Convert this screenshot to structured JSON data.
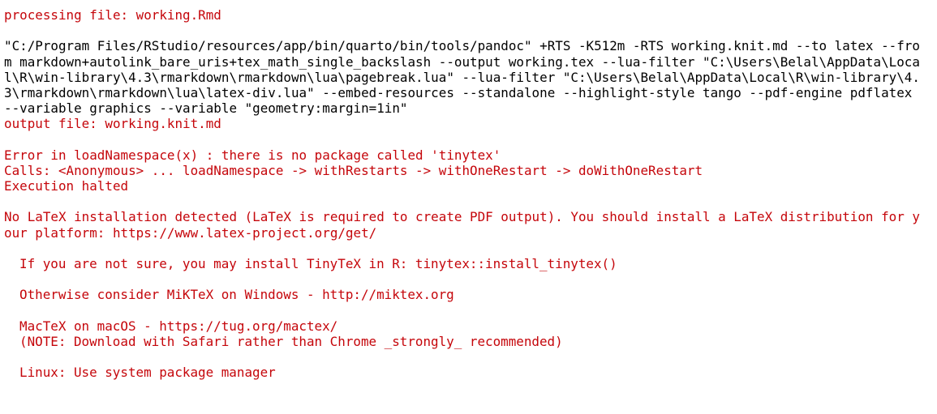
{
  "console": {
    "colors": {
      "message": "#c5060b",
      "command": "#000000",
      "background": "#ffffff"
    },
    "processing": "processing file: working.Rmd",
    "command_lines": [
      "\"C:/Program Files/RStudio/resources/app/bin/quarto/bin/tools/pandoc\" +RTS -K512m -RTS working.knit.md --to latex --fro",
      "m markdown+autolink_bare_uris+tex_math_single_backslash --output working.tex --lua-filter \"C:\\Users\\Belal\\AppData\\Loca",
      "l\\R\\win-library\\4.3\\rmarkdown\\rmarkdown\\lua\\pagebreak.lua\" --lua-filter \"C:\\Users\\Belal\\AppData\\Local\\R\\win-library\\4.",
      "3\\rmarkdown\\rmarkdown\\lua\\latex-div.lua\" --embed-resources --standalone --highlight-style tango --pdf-engine pdflatex",
      "--variable graphics --variable \"geometry:margin=1in\""
    ],
    "output_file": "output file: working.knit.md",
    "error": "Error in loadNamespace(x) : there is no package called 'tinytex'",
    "calls": "Calls: <Anonymous> ... loadNamespace -> withRestarts -> withOneRestart -> doWithOneRestart",
    "halted": "Execution halted",
    "latex_missing_1": "No LaTeX installation detected (LaTeX is required to create PDF output). You should install a LaTeX distribution for y",
    "latex_missing_2": "our platform: https://www.latex-project.org/get/",
    "tip_tinytex": "If you are not sure, you may install TinyTeX in R: tinytex::install_tinytex()",
    "tip_miktex": "Otherwise consider MiKTeX on Windows - http://miktex.org",
    "tip_mactex": "MacTeX on macOS - https://tug.org/mactex/",
    "tip_mactex_note": "(NOTE: Download with Safari rather than Chrome _strongly_ recommended)",
    "tip_linux": "Linux: Use system package manager"
  }
}
